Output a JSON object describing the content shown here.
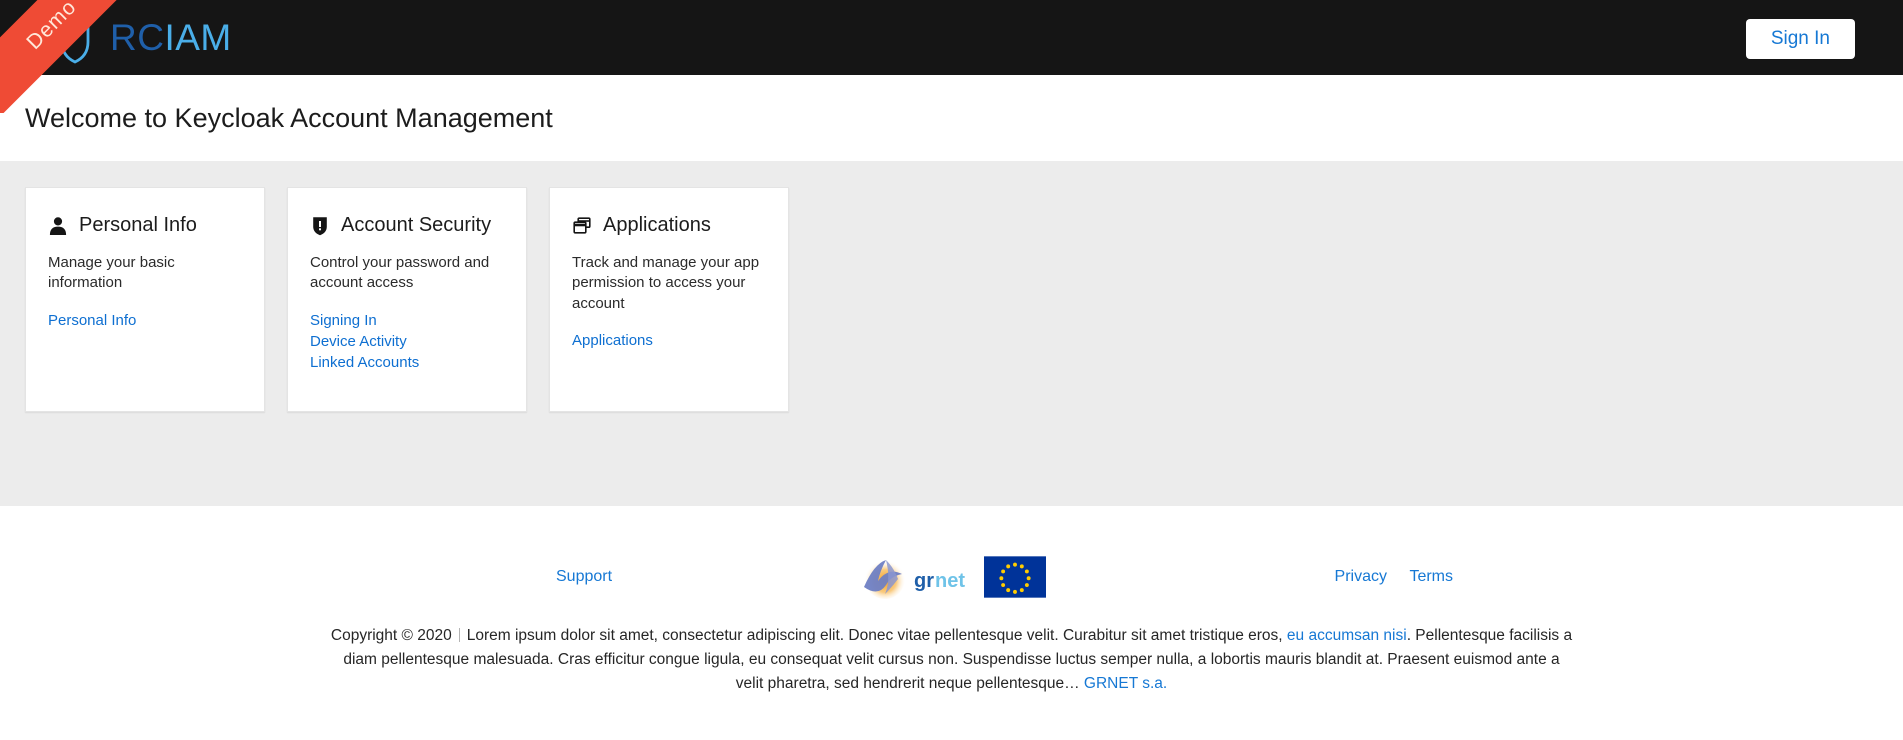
{
  "header": {
    "logo": {
      "text_primary": "RC",
      "text_secondary": "IAM",
      "color_primary": "#1f5fa9",
      "color_secondary": "#4aaee8"
    },
    "ribbon_label": "Demo",
    "ribbon_color": "#ef4b35",
    "signin_label": "Sign In",
    "background": "#151515"
  },
  "page": {
    "title": "Welcome to Keycloak Account Management"
  },
  "cards": [
    {
      "icon": "user-icon",
      "title": "Personal Info",
      "description": "Manage your basic information",
      "links": [
        "Personal Info"
      ]
    },
    {
      "icon": "shield-icon",
      "title": "Account Security",
      "description": "Control your password and account access",
      "links": [
        "Signing In",
        "Device Activity",
        "Linked Accounts"
      ]
    },
    {
      "icon": "applications-icon",
      "title": "Applications",
      "description": "Track and manage your app permission to access your account",
      "links": [
        "Applications"
      ]
    }
  ],
  "footer": {
    "support_label": "Support",
    "privacy_label": "Privacy",
    "terms_label": "Terms",
    "grnet_logo": {
      "text_bold": "gr",
      "text_light": "net",
      "color_bold": "#1f5fa9",
      "color_light": "#6fc3e8"
    },
    "eu_flag": {
      "background": "#003399",
      "star_color": "#ffcc00",
      "star_count": 12
    },
    "copyright_prefix": "Copyright © 2020",
    "copyright_line1_before_link": "Lorem ipsum dolor sit amet, consectetur adipiscing elit. Donec vitae pellentesque velit. Curabitur sit amet tristique eros, ",
    "copyright_link1": "eu accumsan nisi",
    "copyright_line1_after_link": ". Pellentesque facilisis a diam pellentesque malesuada. Cras efficitur congue ligula, eu consequat velit cursus non. Suspendisse luctus semper nulla, a lobortis mauris blandit at. Praesent euismod ante a velit pharetra, sed hendrerit neque pellentesque… ",
    "copyright_link2": "GRNET s.a.",
    "copyright_suffix": ""
  },
  "colors": {
    "accent_blue": "#1678d4",
    "content_bg": "#ececec",
    "card_bg": "#ffffff"
  }
}
